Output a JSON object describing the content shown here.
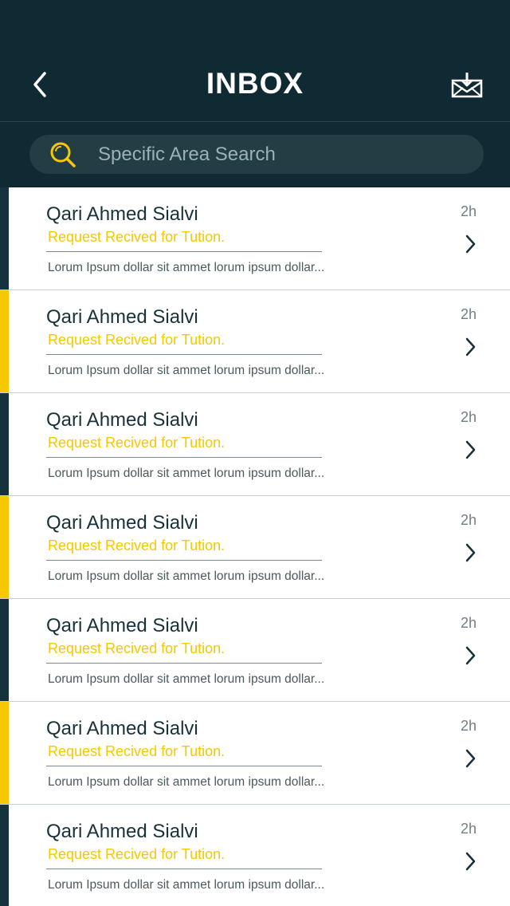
{
  "header": {
    "title": "INBOX",
    "back_icon": "chevron-left-icon",
    "inbox_icon": "inbox-download-icon"
  },
  "search": {
    "placeholder": "Specific Area Search",
    "value": ""
  },
  "colors": {
    "header_bg": "#0f2a33",
    "search_bg": "#233d45",
    "accent_yellow": "#f5c800",
    "accent_dark": "#17323a"
  },
  "messages": [
    {
      "name": "Qari Ahmed Sialvi",
      "subject": "Request Recived for Tution.",
      "preview": "Lorum Ipsum dollar sit ammet lorum ipsum dollar...",
      "time": "2h",
      "accent": "dark"
    },
    {
      "name": "Qari Ahmed Sialvi",
      "subject": "Request Recived for Tution.",
      "preview": "Lorum Ipsum dollar sit ammet lorum ipsum dollar...",
      "time": "2h",
      "accent": "yellow"
    },
    {
      "name": "Qari Ahmed Sialvi",
      "subject": "Request Recived for Tution.",
      "preview": "Lorum Ipsum dollar sit ammet lorum ipsum dollar...",
      "time": "2h",
      "accent": "dark"
    },
    {
      "name": "Qari Ahmed Sialvi",
      "subject": "Request Recived for Tution.",
      "preview": "Lorum Ipsum dollar sit ammet lorum ipsum dollar...",
      "time": "2h",
      "accent": "yellow"
    },
    {
      "name": "Qari Ahmed Sialvi",
      "subject": "Request Recived for Tution.",
      "preview": "Lorum Ipsum dollar sit ammet lorum ipsum dollar...",
      "time": "2h",
      "accent": "dark"
    },
    {
      "name": "Qari Ahmed Sialvi",
      "subject": "Request Recived for Tution.",
      "preview": "Lorum Ipsum dollar sit ammet lorum ipsum dollar...",
      "time": "2h",
      "accent": "yellow"
    },
    {
      "name": "Qari Ahmed Sialvi",
      "subject": "Request Recived for Tution.",
      "preview": "Lorum Ipsum dollar sit ammet lorum ipsum dollar...",
      "time": "2h",
      "accent": "dark"
    }
  ]
}
